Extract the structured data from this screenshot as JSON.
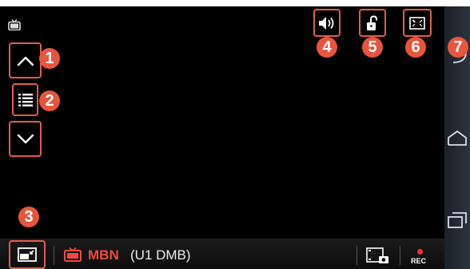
{
  "app": {
    "channel_name": "MBN",
    "channel_info": "(U1 DMB)",
    "rec_label": "REC"
  },
  "callouts": [
    "1",
    "2",
    "3",
    "4",
    "5",
    "6",
    "7"
  ],
  "colors": {
    "callout": "#e8553d",
    "outline": "#e25d4b",
    "channel": "#f04a3c",
    "rec_dot": "#e8343a",
    "accent_green": "#3ad1a4",
    "background": "#000000",
    "nav_bar": "#222a33"
  },
  "icons": {
    "tv": "tv-icon",
    "channel_up": "chevron-up-icon",
    "channel_list": "list-icon",
    "channel_down": "chevron-down-icon",
    "pip": "picture-in-picture-icon",
    "volume": "speaker-icon",
    "lock": "unlock-icon",
    "screen_ratio": "fullscreen-icon",
    "menu": "more-vertical-icon",
    "capture": "camera-capture-icon",
    "record": "record-icon",
    "back": "back-icon",
    "home": "home-icon",
    "recent": "recent-apps-icon"
  }
}
